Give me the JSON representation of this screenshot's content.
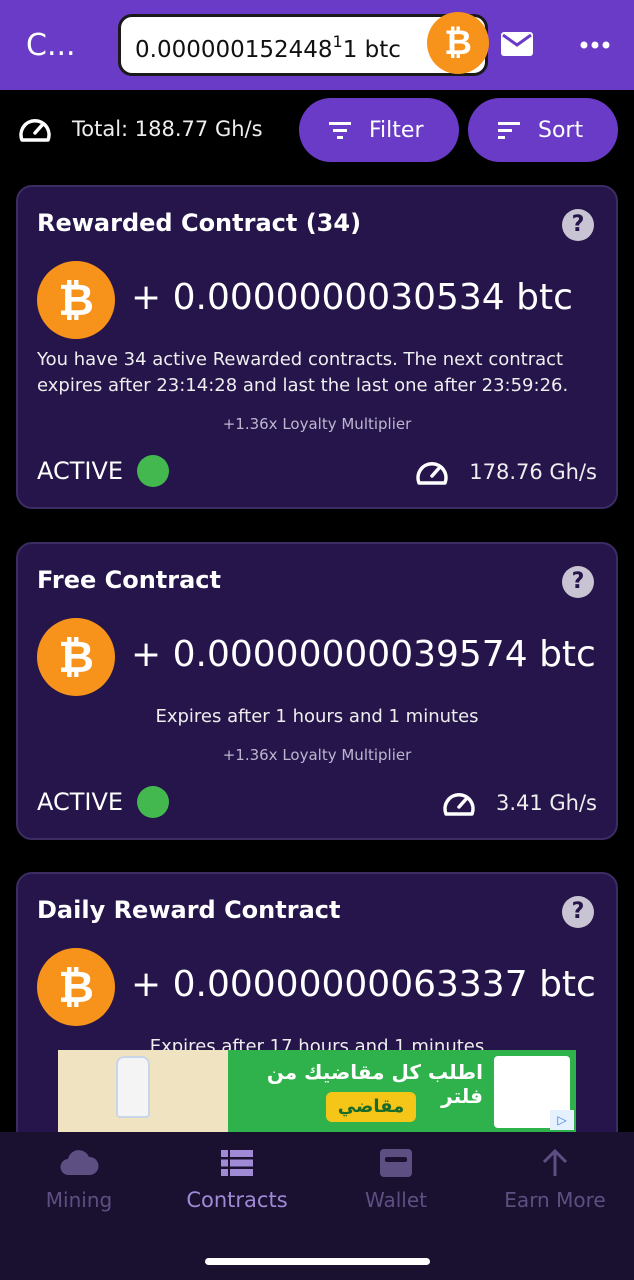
{
  "header": {
    "app_title": "C...",
    "balance_main": "0.000000152448",
    "balance_sup": "1",
    "balance_tail": "1 btc",
    "coin_symbol": "₿",
    "icons": [
      "mail-icon",
      "more-icon"
    ]
  },
  "toolbar": {
    "total_label": "Total: 188.77 Gh/s",
    "filter_label": "Filter",
    "sort_label": "Sort"
  },
  "contracts": [
    {
      "title": "Rewarded Contract (34)",
      "help": "?",
      "reward_main": "+ 0.0000000030534",
      "reward_tail": " btc",
      "description": "You have 34 active Rewarded contracts. The next contract expires after 23:14:28 and last the last one after 23:59:26.",
      "loyalty": "+1.36x Loyalty Multiplier",
      "status": "ACTIVE",
      "speed": "178.76 Gh/s"
    },
    {
      "title": "Free Contract",
      "help": "?",
      "reward_main": "+ 0.0000000003957",
      "reward_tail": "4 btc",
      "description": "Expires after 1 hours and 1 minutes",
      "loyalty": "+1.36x Loyalty Multiplier",
      "status": "ACTIVE",
      "speed": "3.41 Gh/s"
    },
    {
      "title": "Daily Reward Contract",
      "help": "?",
      "reward_main": "+ 0.0000000006333",
      "reward_tail": "7 btc",
      "description": "Expires after 17 hours and 1 minutes"
    }
  ],
  "ad": {
    "headline": "اطلب كل مقاضيك من فلتر",
    "cta": "مقاضي"
  },
  "bottom_nav": [
    {
      "label": "Mining",
      "icon": "cloud-icon"
    },
    {
      "label": "Contracts",
      "icon": "list-icon",
      "active": true
    },
    {
      "label": "Wallet",
      "icon": "wallet-icon"
    },
    {
      "label": "Earn More",
      "icon": "arrow-up-icon"
    }
  ],
  "colors": {
    "accent": "#6a3bc6",
    "card": "#25154a",
    "bitcoin": "#f7931a",
    "active": "#43b84f"
  }
}
